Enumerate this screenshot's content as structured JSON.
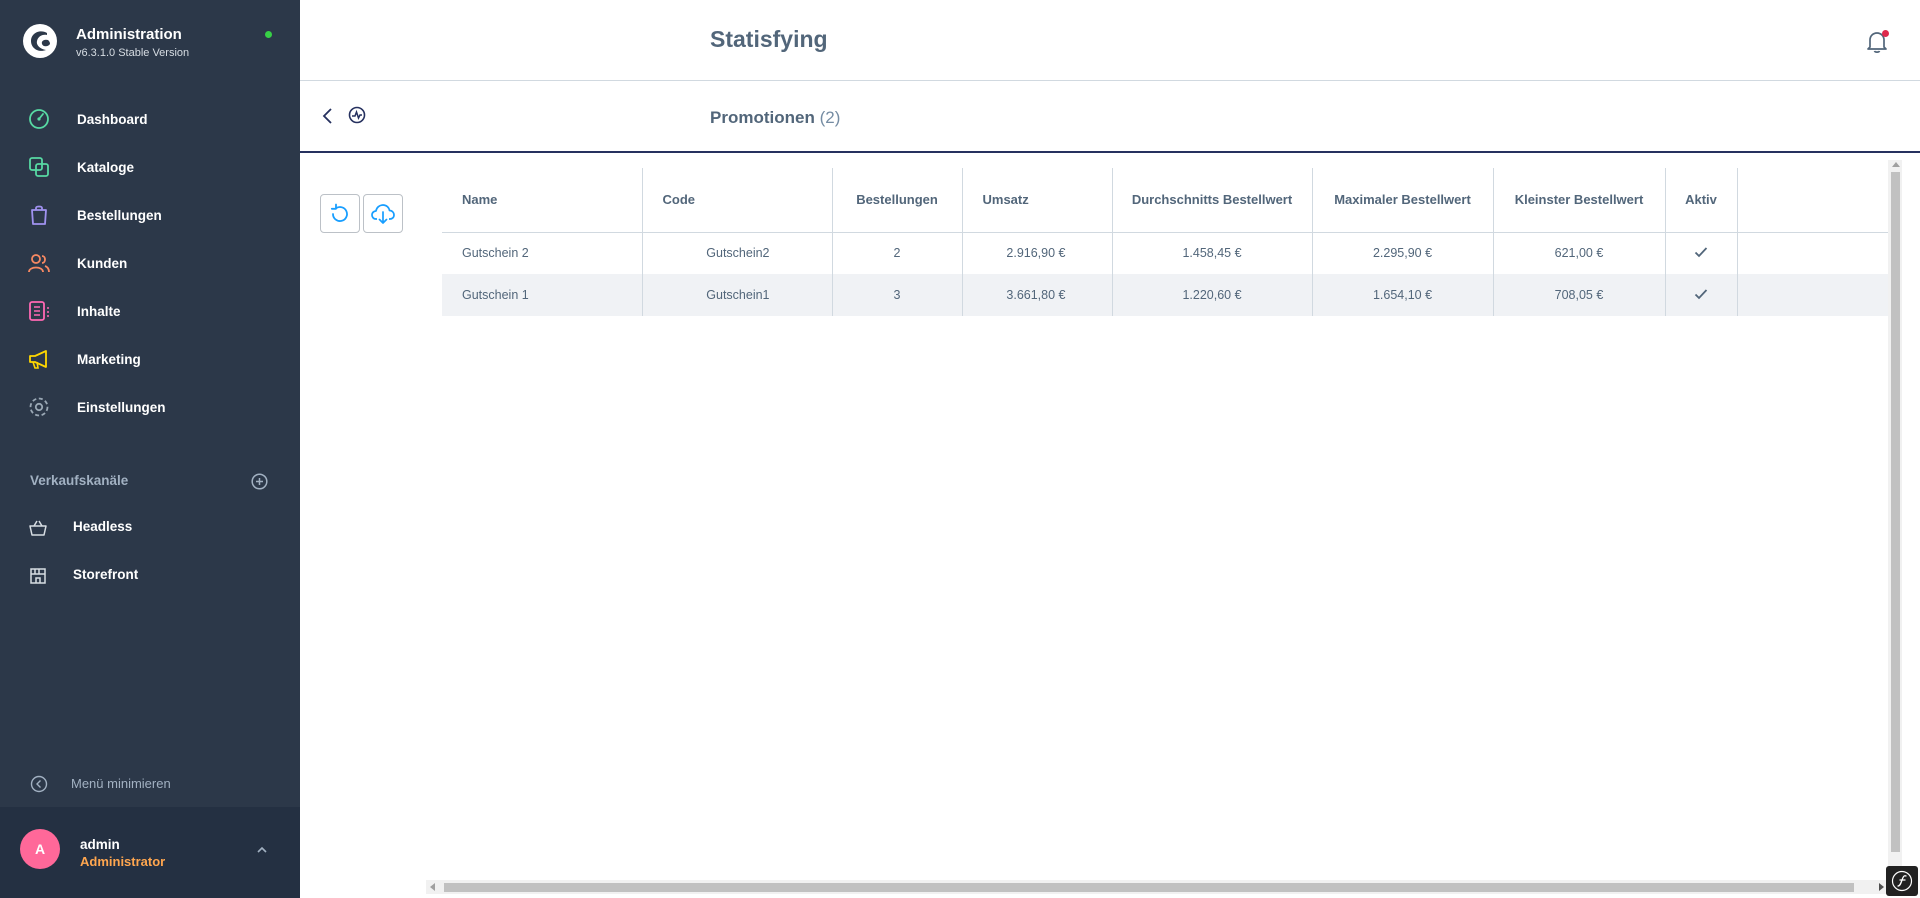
{
  "app": {
    "title": "Administration",
    "version": "v6.3.1.0 Stable Version"
  },
  "sidebar": {
    "items": [
      {
        "label": "Dashboard",
        "icon": "dashboard-icon",
        "color": "#57d9a3"
      },
      {
        "label": "Kataloge",
        "icon": "catalog-icon",
        "color": "#57d9a3"
      },
      {
        "label": "Bestellungen",
        "icon": "orders-bag-icon",
        "color": "#a092f0"
      },
      {
        "label": "Kunden",
        "icon": "customers-icon",
        "color": "#f88962"
      },
      {
        "label": "Inhalte",
        "icon": "content-icon",
        "color": "#ff68b4"
      },
      {
        "label": "Marketing",
        "icon": "marketing-megaphone-icon",
        "color": "#ffd700"
      },
      {
        "label": "Einstellungen",
        "icon": "settings-gear-icon",
        "color": "#9aa8b5"
      }
    ],
    "sales_channels_title": "Verkaufskanäle",
    "sales_channels": [
      {
        "label": "Headless",
        "icon": "basket-icon"
      },
      {
        "label": "Storefront",
        "icon": "storefront-icon"
      }
    ],
    "minimize_label": "Menü minimieren"
  },
  "user": {
    "initial": "A",
    "name": "admin",
    "role": "Administrator"
  },
  "header": {
    "title": "Statisfying"
  },
  "smartbar": {
    "title": "Promotionen",
    "count": "(2)"
  },
  "actions": {
    "reset_icon": "refresh-icon",
    "download_icon": "cloud-download-icon"
  },
  "table": {
    "columns": [
      "Name",
      "Code",
      "Bestellungen",
      "Umsatz",
      "Durchschnitts Bestellwert",
      "Maximaler Bestellwert",
      "Kleinster Bestellwert",
      "Aktiv"
    ],
    "rows": [
      {
        "name": "Gutschein 2",
        "code": "Gutschein2",
        "orders": "2",
        "revenue": "2.916,90 €",
        "avg": "1.458,45 €",
        "max": "2.295,90 €",
        "min": "621,00 €",
        "active": true
      },
      {
        "name": "Gutschein 1",
        "code": "Gutschein1",
        "orders": "3",
        "revenue": "3.661,80 €",
        "avg": "1.220,60 €",
        "max": "1.654,10 €",
        "min": "708,05 €",
        "active": true
      }
    ]
  },
  "colors": {
    "sidebar_bg": "#2c3849",
    "accent": "#189eff",
    "smartbar_border": "#26315f",
    "avatar": "#ff6899",
    "role": "#ffa64f",
    "status_online": "#37d046",
    "notification": "#de294c"
  }
}
